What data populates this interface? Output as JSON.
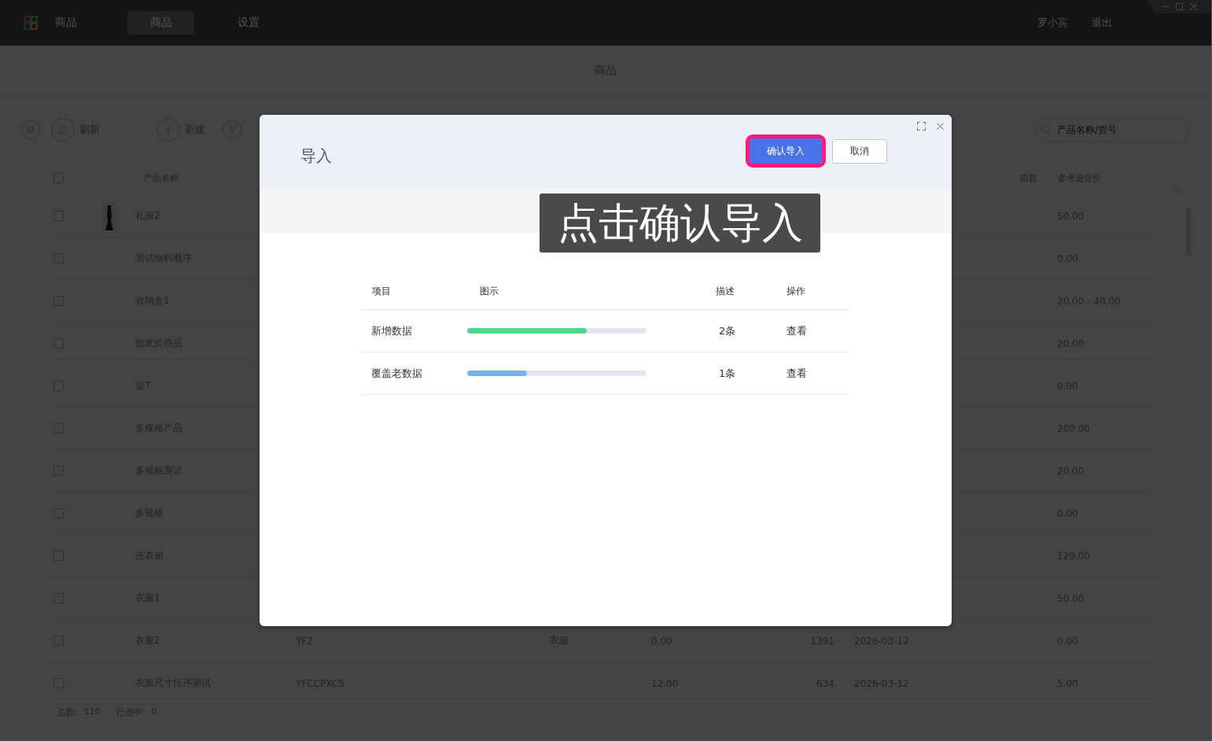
{
  "app": {
    "name": "商品",
    "nav_tabs": [
      {
        "label": "商品",
        "selected": true
      },
      {
        "label": "设置",
        "selected": false
      }
    ],
    "user": "罗小宾",
    "logout": "退出"
  },
  "page_title": "商品",
  "toolbar": {
    "refresh": "刷新",
    "create": "新建",
    "search": {
      "placeholder": "产品名称/货号"
    }
  },
  "table": {
    "header": {
      "checked": false,
      "name": "产品名称",
      "column_boxes": "箱数",
      "ref_price": "参考进货价"
    },
    "rows": [
      {
        "checked": false,
        "kind": "picture",
        "name": "礼服2",
        "ref_price": "50.00"
      },
      {
        "checked": false,
        "name": "测试物料顺序",
        "ref_price": "0.00"
      },
      {
        "checked": false,
        "name": "收纳盒1",
        "ref_price": "20.00 - 40.00"
      },
      {
        "checked": false,
        "name": "批发价商品",
        "ref_price": "20.00"
      },
      {
        "checked": false,
        "name": "短T",
        "ref_price": "0.00"
      },
      {
        "checked": false,
        "name": "多规格产品",
        "ref_price": "200.00"
      },
      {
        "checked": false,
        "name": "多规格测试",
        "ref_price": "20.00"
      },
      {
        "checked": false,
        "name": "多规格",
        "ref_price": "0.00"
      },
      {
        "checked": false,
        "name": "连衣裙",
        "ref_price": "120.00"
      },
      {
        "checked": false,
        "name": "衣服1",
        "ref_price": "50.00"
      },
      {
        "checked": false,
        "name": "衣服2",
        "code": "YF2",
        "category": "衣服",
        "price": "0.00",
        "quantity": "1391",
        "date": "2026-03-12",
        "ref_price": "0.00"
      },
      {
        "checked": false,
        "name": "衣服尺寸排序测试",
        "code": "YFCCPXCS",
        "price": "12.00",
        "quantity": "634",
        "date": "2026-03-12",
        "ref_price": "5.00"
      }
    ]
  },
  "footer": {
    "total_label": "总数:",
    "total": "110",
    "selected_label": "已选中:",
    "selected": "0"
  },
  "dialog": {
    "title": "导入",
    "confirm": "确认导入",
    "confirm_highlighted": true,
    "cancel": "取消",
    "columns": [
      "项目",
      "图示",
      "描述",
      "操作"
    ],
    "rows": [
      {
        "item": "新增数据",
        "level": 0.667,
        "color": "#4cd98c",
        "count": "2条",
        "action": "查看"
      },
      {
        "item": "覆盖老数据",
        "level": 0.333,
        "color": "#74b4ec",
        "count": "1条",
        "action": "查看"
      }
    ]
  },
  "hint": "点击确认导入"
}
